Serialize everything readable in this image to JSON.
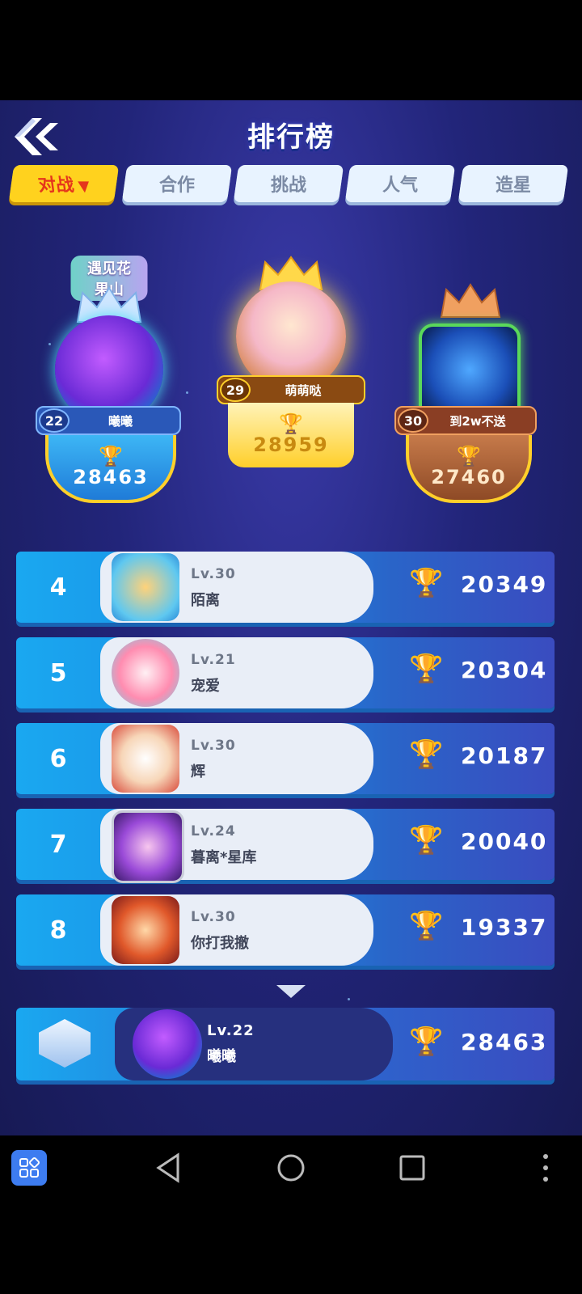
{
  "header": {
    "title": "排行榜"
  },
  "tabs": [
    {
      "label": "对战",
      "active": true,
      "caret": "▼"
    },
    {
      "label": "合作"
    },
    {
      "label": "挑战"
    },
    {
      "label": "人气"
    },
    {
      "label": "造星"
    }
  ],
  "podium": {
    "first": {
      "badge": "",
      "level": "29",
      "name": "萌萌哒",
      "score": "28959"
    },
    "second": {
      "badge": "遇见花果山",
      "level": "22",
      "name": "曦曦",
      "score": "28463"
    },
    "third": {
      "level": "30",
      "name": "到2w不送",
      "score": "27460"
    }
  },
  "list": [
    {
      "rank": "4",
      "level": "Lv.30",
      "name": "陌离",
      "score": "20349"
    },
    {
      "rank": "5",
      "level": "Lv.21",
      "name": "宠爱",
      "score": "20304"
    },
    {
      "rank": "6",
      "level": "Lv.30",
      "name": "辉",
      "score": "20187"
    },
    {
      "rank": "7",
      "level": "Lv.24",
      "name": "暮离*星库",
      "score": "20040"
    },
    {
      "rank": "8",
      "level": "Lv.30",
      "name": "你打我撤",
      "score": "19337"
    }
  ],
  "me": {
    "level": "Lv.22",
    "name": "曦曦",
    "score": "28463"
  },
  "colors": {
    "accent": "#ffd21e",
    "background": "#22257a",
    "row": "#1aa8f0"
  },
  "icons": {
    "back": "double-chevron-left-icon",
    "trophy": "trophy-icon"
  }
}
